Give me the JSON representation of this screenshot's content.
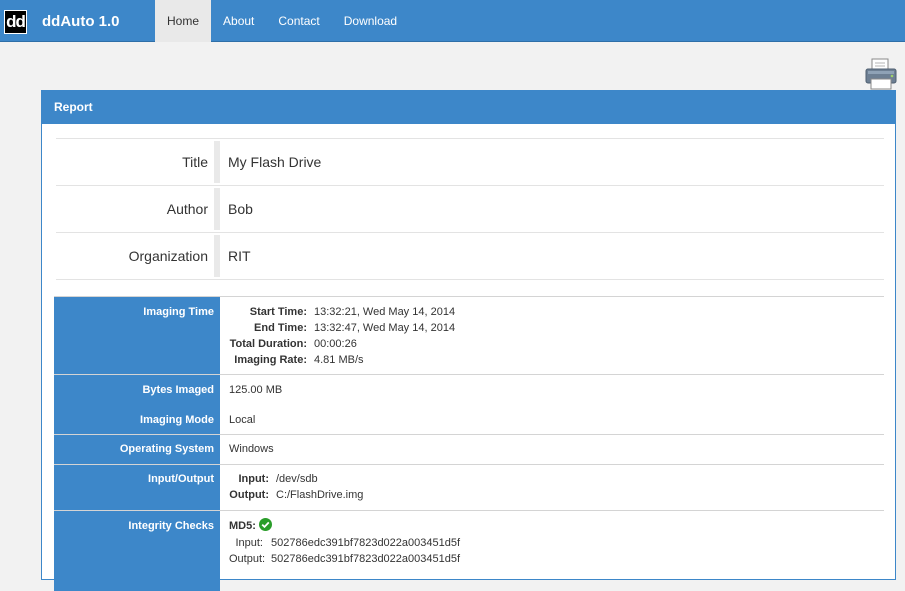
{
  "app": {
    "logo_text": "dd",
    "title": "ddAuto 1.0"
  },
  "nav": [
    {
      "label": "Home",
      "active": true
    },
    {
      "label": "About",
      "active": false
    },
    {
      "label": "Contact",
      "active": false
    },
    {
      "label": "Download",
      "active": false
    }
  ],
  "panel": {
    "title": "Report"
  },
  "meta": [
    {
      "label": "Title",
      "value": "My Flash Drive"
    },
    {
      "label": "Author",
      "value": "Bob"
    },
    {
      "label": "Organization",
      "value": "RIT"
    }
  ],
  "imaging_time": {
    "label": "Imaging Time",
    "start_label": "Start Time:",
    "start_value": "13:32:21, Wed May 14, 2014",
    "end_label": "End Time:",
    "end_value": "13:32:47, Wed May 14, 2014",
    "duration_label": "Total Duration:",
    "duration_value": "00:00:26",
    "rate_label": "Imaging Rate:",
    "rate_value": "4.81 MB/s"
  },
  "bytes_imaged": {
    "label": "Bytes Imaged",
    "value": "125.00 MB"
  },
  "imaging_mode": {
    "label": "Imaging Mode",
    "value": "Local"
  },
  "operating_system": {
    "label": "Operating System",
    "value": "Windows"
  },
  "io": {
    "label": "Input/Output",
    "input_label": "Input:",
    "input_value": "/dev/sdb",
    "output_label": "Output:",
    "output_value": "C:/FlashDrive.img"
  },
  "integrity": {
    "label": "Integrity Checks",
    "md5_label": "MD5:",
    "input_label": "Input:",
    "input_value": "502786edc391bf7823d022a003451d5f",
    "output_label": "Output:",
    "output_value": "502786edc391bf7823d022a003451d5f"
  },
  "colors": {
    "primary": "#3d87c9",
    "success": "#2a9d2a"
  }
}
